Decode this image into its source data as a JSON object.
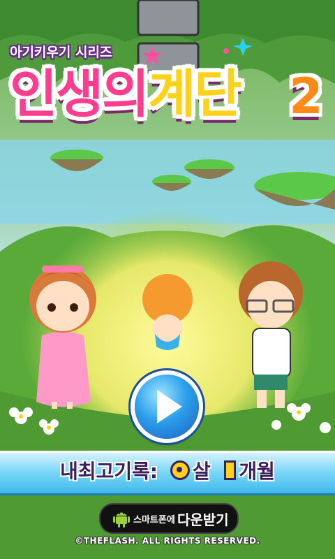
{
  "title": {
    "series": "아기키우기 시리즈",
    "main": "인생의",
    "main_accent": "계단",
    "number": "2"
  },
  "play_button": {
    "icon": "play-icon"
  },
  "record": {
    "label": "내최고기록:",
    "age_unit": "살",
    "month_unit": "개월"
  },
  "download": {
    "small_text": "스마트폰에",
    "big_text": "다운받기",
    "icon": "android-icon"
  },
  "copyright": "©THEFLASH. ALL RIGHTS RESERVED.",
  "colors": {
    "title_pink": "#ff3d8e",
    "title_yellow": "#ffd21a",
    "play_blue": "#2c9fea",
    "record_bar": "#7fd8f8"
  }
}
